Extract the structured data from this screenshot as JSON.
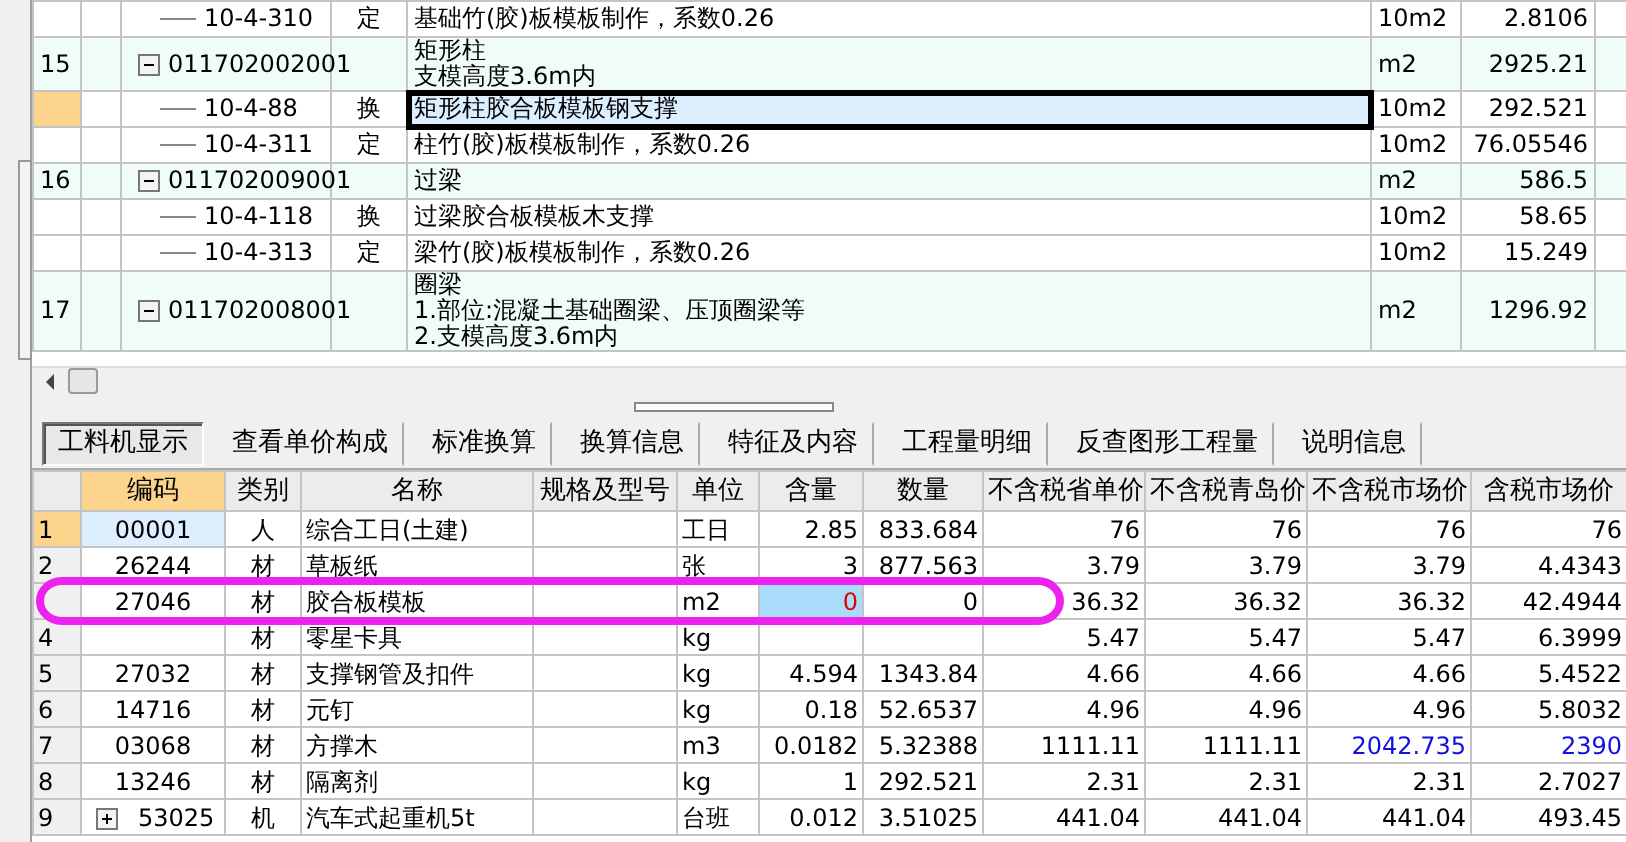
{
  "top_grid": {
    "rows": [
      {
        "number": "",
        "kind": "sub",
        "code": "10-4-310",
        "type": "定",
        "name_lines": [
          "基础竹(胶)板模板制作，系数0.26"
        ],
        "unit": "10m2",
        "quantity": "2.8106",
        "selected": false,
        "focused": false
      },
      {
        "number": "15",
        "kind": "item",
        "expanded": true,
        "code": "011702002001",
        "type": "",
        "name_lines": [
          "矩形柱",
          "支模高度3.6m内"
        ],
        "unit": "m2",
        "quantity": "2925.21",
        "selected": false,
        "focused": false
      },
      {
        "number": "",
        "kind": "sub",
        "code": "10-4-88",
        "type": "换",
        "name_lines": [
          "矩形柱胶合板模板钢支撑"
        ],
        "unit": "10m2",
        "quantity": "292.521",
        "selected": true,
        "focused": true
      },
      {
        "number": "",
        "kind": "sub",
        "code": "10-4-311",
        "type": "定",
        "name_lines": [
          "柱竹(胶)板模板制作，系数0.26"
        ],
        "unit": "10m2",
        "quantity": "76.05546",
        "selected": false,
        "focused": false
      },
      {
        "number": "16",
        "kind": "item",
        "expanded": true,
        "code": "011702009001",
        "type": "",
        "name_lines": [
          "过梁"
        ],
        "unit": "m2",
        "quantity": "586.5",
        "selected": false,
        "focused": false
      },
      {
        "number": "",
        "kind": "sub",
        "code": "10-4-118",
        "type": "换",
        "name_lines": [
          "过梁胶合板模板木支撑"
        ],
        "unit": "10m2",
        "quantity": "58.65",
        "selected": false,
        "focused": false
      },
      {
        "number": "",
        "kind": "sub",
        "code": "10-4-313",
        "type": "定",
        "name_lines": [
          "梁竹(胶)板模板制作，系数0.26"
        ],
        "unit": "10m2",
        "quantity": "15.249",
        "selected": false,
        "focused": false
      },
      {
        "number": "17",
        "kind": "item",
        "expanded": true,
        "code": "011702008001",
        "type": "",
        "name_lines": [
          "圈梁",
          "1.部位:混凝土基础圈梁、压顶圈梁等",
          "2.支模高度3.6m内"
        ],
        "unit": "m2",
        "quantity": "1296.92",
        "selected": false,
        "focused": false
      }
    ]
  },
  "tabs": [
    {
      "label": "工料机显示",
      "selected": true
    },
    {
      "label": "查看单价构成",
      "selected": false
    },
    {
      "label": "标准换算",
      "selected": false
    },
    {
      "label": "换算信息",
      "selected": false
    },
    {
      "label": "特征及内容",
      "selected": false
    },
    {
      "label": "工程量明细",
      "selected": false
    },
    {
      "label": "反查图形工程量",
      "selected": false
    },
    {
      "label": "说明信息",
      "selected": false
    }
  ],
  "resource_grid": {
    "columns": [
      {
        "label": "编码",
        "selected": true
      },
      {
        "label": "类别",
        "selected": false
      },
      {
        "label": "名称",
        "selected": false
      },
      {
        "label": "规格及型号",
        "selected": false
      },
      {
        "label": "单位",
        "selected": false
      },
      {
        "label": "含量",
        "selected": false
      },
      {
        "label": "数量",
        "selected": false
      },
      {
        "label": "不含税省单价",
        "selected": false
      },
      {
        "label": "不含税青岛价",
        "selected": false
      },
      {
        "label": "不含税市场价",
        "selected": false
      },
      {
        "label": "含税市场价",
        "selected": false
      }
    ],
    "rows": [
      {
        "number": "1",
        "selected": true,
        "expandable": false,
        "cells": [
          {
            "text": "00001",
            "kind": "current"
          },
          "人",
          "综合工日(土建)",
          "",
          "工日",
          "2.85",
          "833.684",
          "76",
          "76",
          "76",
          "76"
        ]
      },
      {
        "number": "2",
        "selected": false,
        "expandable": false,
        "cells": [
          "26244",
          "材",
          "草板纸",
          "",
          "张",
          "3",
          "877.563",
          "3.79",
          "3.79",
          "3.79",
          "4.4343"
        ]
      },
      {
        "number": "",
        "selected": false,
        "expandable": false,
        "cells": [
          "27046",
          "材",
          "胶合板模板",
          "",
          "m2",
          {
            "text": "0",
            "kind": "changed"
          },
          "0",
          "36.32",
          "36.32",
          "36.32",
          "42.4944"
        ]
      },
      {
        "number": "4",
        "selected": false,
        "expandable": false,
        "cells": [
          "",
          "材",
          "零星卡具",
          "",
          "kg",
          "",
          "",
          "5.47",
          "5.47",
          "5.47",
          "6.3999"
        ]
      },
      {
        "number": "5",
        "selected": false,
        "expandable": false,
        "cells": [
          "27032",
          "材",
          "支撑钢管及扣件",
          "",
          "kg",
          "4.594",
          "1343.84",
          "4.66",
          "4.66",
          "4.66",
          "5.4522"
        ]
      },
      {
        "number": "6",
        "selected": false,
        "expandable": false,
        "cells": [
          "14716",
          "材",
          "元钉",
          "",
          "kg",
          "0.18",
          "52.6537",
          "4.96",
          "4.96",
          "4.96",
          "5.8032"
        ]
      },
      {
        "number": "7",
        "selected": false,
        "expandable": false,
        "cells": [
          "03068",
          "材",
          "方撑木",
          "",
          "m3",
          "0.0182",
          "5.32388",
          "1111.11",
          "1111.11",
          {
            "text": "2042.735",
            "kind": "price_changed"
          },
          {
            "text": "2390",
            "kind": "price_changed"
          }
        ]
      },
      {
        "number": "8",
        "selected": false,
        "expandable": false,
        "cells": [
          "13246",
          "材",
          "隔离剂",
          "",
          "kg",
          "1",
          "292.521",
          "2.31",
          "2.31",
          "2.31",
          "2.7027"
        ]
      },
      {
        "number": "9",
        "selected": false,
        "expandable": true,
        "expanded": false,
        "cells": [
          "53025",
          "机",
          "汽车式起重机5t",
          "",
          "台班",
          "0.012",
          "3.51025",
          "441.04",
          "441.04",
          "441.04",
          "493.45"
        ]
      }
    ]
  }
}
